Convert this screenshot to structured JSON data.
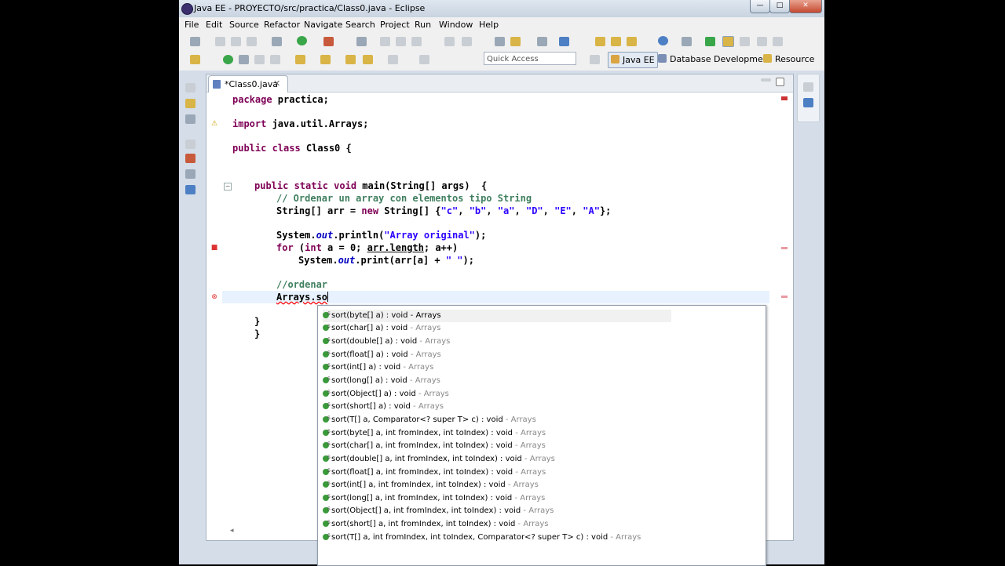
{
  "window": {
    "title": "Java EE - PROYECTO/src/practica/Class0.java - Eclipse",
    "controls": {
      "minimize": "—",
      "maximize": "□",
      "close": "✕"
    }
  },
  "menu": [
    "File",
    "Edit",
    "Source",
    "Refactor",
    "Navigate",
    "Search",
    "Project",
    "Run",
    "Window",
    "Help"
  ],
  "toolbar": {
    "quick_access_placeholder": "Quick Access",
    "perspectives": [
      "Java EE",
      "Database Development",
      "Resource"
    ]
  },
  "editor": {
    "tab_label": "*Class0.java",
    "tab_close": "✕",
    "code": {
      "package_kw": "package",
      "package_name": " practica;",
      "import_kw": "import",
      "import_name": " java.util.Arrays;",
      "class_kw": "public class",
      "class_name": " Class0 {",
      "main_kw": "public static void",
      "main_sig": " main(String[] args)  {",
      "comment_sort": "// Ordenar un array con elementos tipo String",
      "arr_type": "String[] arr = ",
      "arr_new_kw": "new",
      "arr_ctor": " String[] {",
      "arr_s1": "\"c\"",
      "arr_s2": "\"b\"",
      "arr_s3": "\"a\"",
      "arr_s4": "\"D\"",
      "arr_s5": "\"E\"",
      "arr_s6": "\"A\"",
      "comma": ", ",
      "arr_end": "};",
      "println_pre": "System.",
      "out": "out",
      "println_mid": ".println(",
      "println_str": "\"Array original\"",
      "println_end": ");",
      "for_kw": "for",
      "for_open": " (",
      "int_kw": "int",
      "for_init": " a = 0; ",
      "for_cond": "arr.length",
      "for_rest": "; a++)",
      "print_pre": "System.",
      "print_mid": ".print(arr[a] + ",
      "print_str": "\" \"",
      "print_end": ");",
      "comment_ordenar": "//ordenar",
      "arrays_typed": "Arrays.so",
      "close_brace": "}"
    }
  },
  "autocomplete": {
    "items": [
      {
        "sig": "sort(byte[] a) : void - Arrays",
        "owner": ""
      },
      {
        "sig": "sort(char[] a) : void",
        "owner": " - Arrays"
      },
      {
        "sig": "sort(double[] a) : void",
        "owner": " - Arrays"
      },
      {
        "sig": "sort(float[] a) : void",
        "owner": " - Arrays"
      },
      {
        "sig": "sort(int[] a) : void",
        "owner": " - Arrays"
      },
      {
        "sig": "sort(long[] a) : void",
        "owner": " - Arrays"
      },
      {
        "sig": "sort(Object[] a) : void",
        "owner": " - Arrays"
      },
      {
        "sig": "sort(short[] a) : void",
        "owner": " - Arrays"
      },
      {
        "sig": "sort(T[] a, Comparator<? super T> c) : void",
        "owner": " - Arrays"
      },
      {
        "sig": "sort(byte[] a, int fromIndex, int toIndex) : void",
        "owner": " - Arrays"
      },
      {
        "sig": "sort(char[] a, int fromIndex, int toIndex) : void",
        "owner": " - Arrays"
      },
      {
        "sig": "sort(double[] a, int fromIndex, int toIndex) : void",
        "owner": " - Arrays"
      },
      {
        "sig": "sort(float[] a, int fromIndex, int toIndex) : void",
        "owner": " - Arrays"
      },
      {
        "sig": "sort(int[] a, int fromIndex, int toIndex) : void",
        "owner": " - Arrays"
      },
      {
        "sig": "sort(long[] a, int fromIndex, int toIndex) : void",
        "owner": " - Arrays"
      },
      {
        "sig": "sort(Object[] a, int fromIndex, int toIndex) : void",
        "owner": " - Arrays"
      },
      {
        "sig": "sort(short[] a, int fromIndex, int toIndex) : void",
        "owner": " - Arrays"
      },
      {
        "sig": "sort(T[] a, int fromIndex, int toIndex, Comparator<? super T> c) : void",
        "owner": " - Arrays"
      }
    ]
  }
}
